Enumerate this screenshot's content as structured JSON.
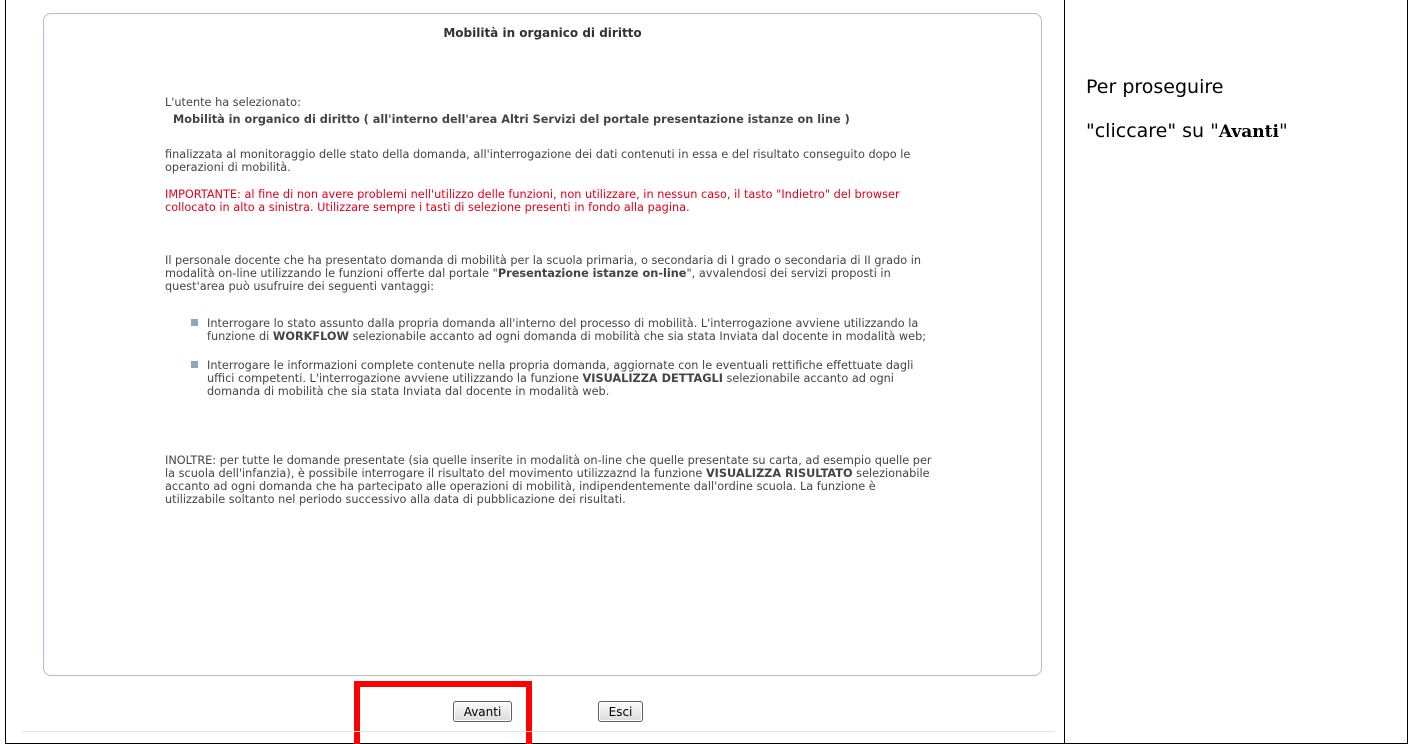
{
  "panel": {
    "title": "Mobilità in organico di diritto",
    "selected_intro": "L'utente ha selezionato:",
    "selected_title": "Mobilità in organico di diritto ( all'interno dell'area Altri Servizi del portale presentazione istanze on line )",
    "purpose": "finalizzata al monitoraggio delle stato della domanda, all'interrogazione dei dati contenuti in essa e del risultato conseguito dopo le operazioni di mobilità.",
    "warning": "IMPORTANTE: al fine di non avere problemi nell'utilizzo delle funzioni, non utilizzare, in nessun caso, il tasto \"Indietro\" del browser collocato in alto a sinistra. Utilizzare sempre i tasti di selezione presenti in fondo alla pagina.",
    "intro2_a": "Il personale docente che ha presentato domanda di mobilità per la scuola primaria, o secondaria di I grado o secondaria di II grado in modalità on-line utilizzando le funzioni offerte dal portale \"",
    "intro2_bold": "Presentazione istanze on-line",
    "intro2_b": "\", avvalendosi dei servizi proposti in quest'area può usufruire dei seguenti vantaggi:",
    "bullets": [
      {
        "pre": "Interrogare lo stato assunto dalla propria domanda all'interno del processo di mobilità. L'interrogazione avviene utilizzando la funzione di ",
        "bold": "WORKFLOW",
        "post": " selezionabile accanto ad ogni domanda di mobilità che sia stata Inviata dal docente in modalità web;"
      },
      {
        "pre": "Interrogare le informazioni complete contenute nella propria domanda, aggiornate con le eventuali rettifiche effettuate dagli uffici competenti. L'interrogazione avviene utilizzando la funzione ",
        "bold": "VISUALIZZA DETTAGLI",
        "post": " selezionabile accanto ad ogni domanda di mobilità che sia stata Inviata dal docente in modalità web."
      }
    ],
    "inoltre_a": "INOLTRE: per tutte le domande presentate (sia quelle inserite in modalità on-line che quelle presentate su carta, ad esempio quelle per la scuola dell'infanzia), è possibile interrogare il risultato del movimento utilizzaznd la funzione ",
    "inoltre_bold": "VISUALIZZA RISULTATO",
    "inoltre_b": " selezionabile accanto ad ogni domanda che ha partecipato alle operazioni di mobilità, indipendentemente dall'ordine scuola. La funzione è utilizzabile soltanto nel periodo successivo alla data di pubblicazione dei risultati."
  },
  "buttons": {
    "avanti": "Avanti",
    "esci": "Esci"
  },
  "instructions": {
    "line1": "Per proseguire",
    "line2_a": "\"cliccare\" su ",
    "q_open": "\"",
    "bold": "Avanti",
    "q_close": "\""
  },
  "colors": {
    "warning": "#e0001a",
    "highlight": "#ff0000",
    "panel_border": "#a9bfd6"
  }
}
